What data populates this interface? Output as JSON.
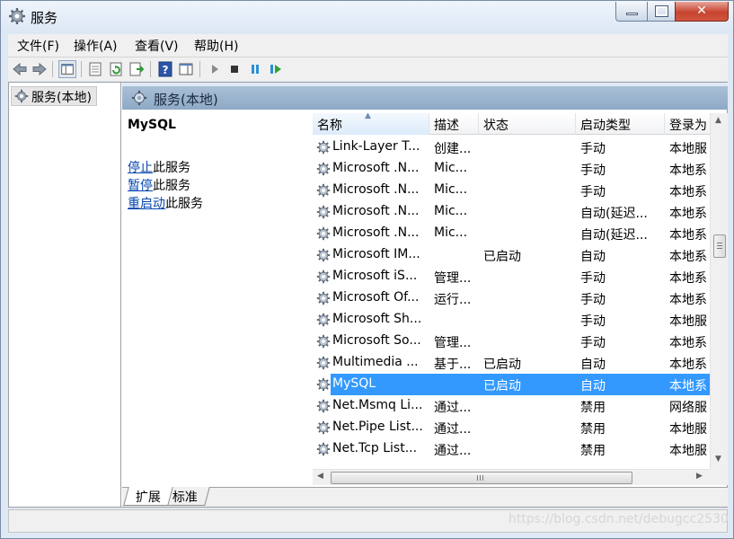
{
  "window": {
    "title": "服务"
  },
  "menubar": {
    "items": [
      {
        "label": "文件(F)"
      },
      {
        "label": "操作(A)"
      },
      {
        "label": "查看(V)"
      },
      {
        "label": "帮助(H)"
      }
    ]
  },
  "tree": {
    "root_label": "服务(本地)"
  },
  "pane": {
    "header_label": "服务(本地)"
  },
  "detail": {
    "service_name": "MySQL",
    "actions": [
      {
        "link": "停止",
        "suffix": "此服务"
      },
      {
        "link": "暂停",
        "suffix": "此服务"
      },
      {
        "link": "重启动",
        "suffix": "此服务"
      }
    ]
  },
  "list": {
    "columns": [
      "名称",
      "描述",
      "状态",
      "启动类型",
      "登录为"
    ],
    "rows": [
      {
        "name": "Link-Layer T...",
        "desc": "创建...",
        "status": "",
        "startup": "手动",
        "logon": "本地服"
      },
      {
        "name": "Microsoft .N...",
        "desc": "Mic...",
        "status": "",
        "startup": "手动",
        "logon": "本地系"
      },
      {
        "name": "Microsoft .N...",
        "desc": "Mic...",
        "status": "",
        "startup": "手动",
        "logon": "本地系"
      },
      {
        "name": "Microsoft .N...",
        "desc": "Mic...",
        "status": "",
        "startup": "自动(延迟...",
        "logon": "本地系"
      },
      {
        "name": "Microsoft .N...",
        "desc": "Mic...",
        "status": "",
        "startup": "自动(延迟...",
        "logon": "本地系"
      },
      {
        "name": "Microsoft IM...",
        "desc": "",
        "status": "已启动",
        "startup": "自动",
        "logon": "本地系"
      },
      {
        "name": "Microsoft iS...",
        "desc": "管理...",
        "status": "",
        "startup": "手动",
        "logon": "本地系"
      },
      {
        "name": "Microsoft Of...",
        "desc": "运行...",
        "status": "",
        "startup": "手动",
        "logon": "本地系"
      },
      {
        "name": "Microsoft Sh...",
        "desc": "",
        "status": "",
        "startup": "手动",
        "logon": "本地服"
      },
      {
        "name": "Microsoft So...",
        "desc": "管理...",
        "status": "",
        "startup": "手动",
        "logon": "本地系"
      },
      {
        "name": "Multimedia ...",
        "desc": "基于...",
        "status": "已启动",
        "startup": "自动",
        "logon": "本地系"
      },
      {
        "name": "MySQL",
        "desc": "",
        "status": "已启动",
        "startup": "自动",
        "logon": "本地系",
        "selected": true
      },
      {
        "name": "Net.Msmq Li...",
        "desc": "通过...",
        "status": "",
        "startup": "禁用",
        "logon": "网络服"
      },
      {
        "name": "Net.Pipe List...",
        "desc": "通过...",
        "status": "",
        "startup": "禁用",
        "logon": "本地服"
      },
      {
        "name": "Net.Tcp List...",
        "desc": "通过...",
        "status": "",
        "startup": "禁用",
        "logon": "本地服"
      }
    ]
  },
  "tabs": [
    {
      "label": "扩展",
      "active": true
    },
    {
      "label": "标准",
      "active": false
    }
  ],
  "watermark": "https://blog.csdn.net/debugcc2530"
}
